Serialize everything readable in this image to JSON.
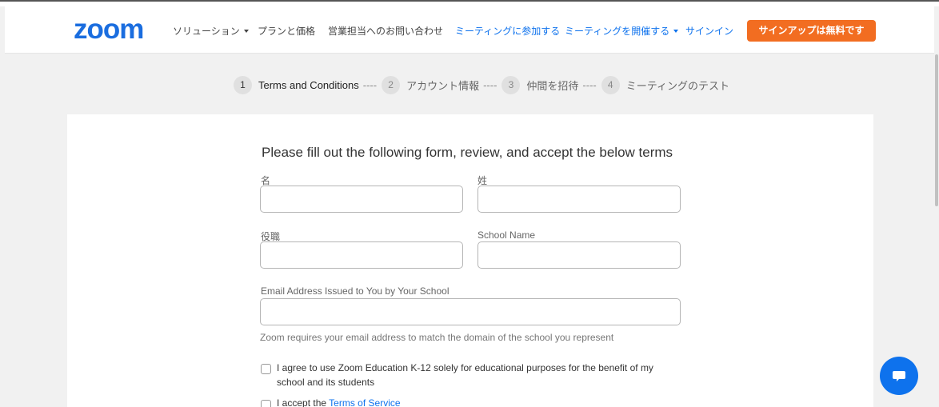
{
  "nav": {
    "logo": "zoom",
    "items": [
      {
        "label": "ソリューション",
        "dropdown": true
      },
      {
        "label": "プランと価格"
      },
      {
        "label": "営業担当へのお問い合わせ"
      },
      {
        "label": "ミーティングに参加する"
      },
      {
        "label": "ミーティングを開催する",
        "dropdown": true
      },
      {
        "label": "サインイン"
      }
    ],
    "signup": "サインアップは無料です"
  },
  "steps": [
    {
      "num": "1",
      "label": "Terms and Conditions",
      "sep": "----"
    },
    {
      "num": "2",
      "label": "アカウント情報",
      "sep": "----"
    },
    {
      "num": "3",
      "label": "仲間を招待",
      "sep": "----"
    },
    {
      "num": "4",
      "label": "ミーティングのテスト"
    }
  ],
  "form": {
    "title": "Please fill out the following form, review, and accept the below terms",
    "first_name_label": "名",
    "last_name_label": "姓",
    "job_title_label": "役職",
    "school_name_label": "School Name",
    "email_label": "Email Address Issued to You by Your School",
    "email_hint": "Zoom requires your email address to match the domain of the school you represent",
    "agree_educational": "I agree to use Zoom Education K-12 solely for educational purposes for the benefit of my school and its students",
    "accept_prefix": "I accept the",
    "terms_link": "Terms of Service"
  },
  "colors": {
    "brand": "#1a6ddf",
    "link": "#0e72ed",
    "signup": "#f26d21"
  },
  "icons": {
    "chat": "chat-bubble-icon"
  }
}
